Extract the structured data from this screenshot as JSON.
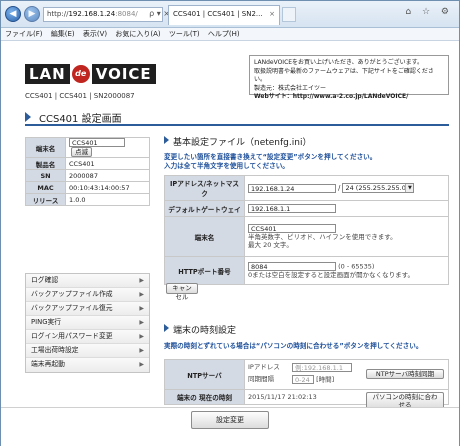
{
  "browser": {
    "back_icon": "back-arrow-icon",
    "forward_icon": "forward-arrow-icon",
    "url_scheme": "http://",
    "url_host": "192.168.1.24",
    "url_port": ":8084/",
    "url_tools": "ρ ▾ ×",
    "tab_title": "CCS401 | CCS401 | SN2...",
    "tab_close": "×",
    "window_icons": "⌂ ☆ ⚙",
    "menu": [
      "ファイル(F)",
      "編集(E)",
      "表示(V)",
      "お気に入り(A)",
      "ツール(T)",
      "ヘルプ(H)"
    ]
  },
  "header": {
    "logo_left": "LAN",
    "logo_mid": "de",
    "logo_right": "VOICE",
    "device_info": "CCS401 | CCS401 | SN2000087",
    "notice_line1": "LANdeVOICEをお買い上げいただき、ありがとうございます。",
    "notice_line2": "取扱説明書や最新のファームウェアは、下記サイトをご確認ください。",
    "notice_line3": "製造元：株式会社エイツー",
    "notice_site_label": "Webサイト",
    "notice_site_url": "：http://www.a-2.co.jp/LANdeVOICE/",
    "page_title": "CCS401 設定画面"
  },
  "device": {
    "rows": [
      {
        "key": "端末名",
        "value": "CCS401",
        "button": "点滅"
      },
      {
        "key": "製品名",
        "value": "CCS401"
      },
      {
        "key": "SN",
        "value": "2000087"
      },
      {
        "key": "MAC",
        "value": "00:10:43:14:00:57"
      },
      {
        "key": "リリース",
        "value": "1.0.0"
      }
    ]
  },
  "sidemenu": {
    "items": [
      "ログ確認",
      "バックアップファイル作成",
      "バックアップファイル復元",
      "PING実行",
      "ログイン用パスワード変更",
      "工場出荷時設定",
      "端末再起動"
    ],
    "arrow": "▶"
  },
  "basic": {
    "heading": "基本設定ファイル（netenfg.ini）",
    "note1": "変更したい箇所を直接書き換えて“設定変更”ボタンを押してください。",
    "note2": "入力は全て半角文字を使用してください。",
    "ip_label": "IPアドレス/ネットマスク",
    "ip_value": "192.168.1.24",
    "ip_sep": "/",
    "mask_value": "24 (255.255.255.0)",
    "gw_label": "デフォルトゲートウェイ",
    "gw_value": "192.168.1.1",
    "name_label": "端末名",
    "name_value": "CCS401",
    "name_hint1": "半角英数字、ピリオド、ハイフンを使用できます。",
    "name_hint2": "最大 20 文字。",
    "port_label": "HTTPポート番号",
    "port_value": "8084",
    "port_range": "(0 - 65535)",
    "port_hint": "0または空白を設定すると設定画面が開かなくなります。",
    "cancel": "キャンセル"
  },
  "time": {
    "heading": "端末の時刻設定",
    "note": "実際の時刻とずれている場合は“パソコンの時刻に合わせる”ボタンを押してください。",
    "ntp_label": "NTPサーバ",
    "ntp_ip_label": "IPアドレス",
    "ntp_ip_placeholder": "例:192.168.1.1",
    "ntp_sync_label": "同期間隔",
    "ntp_sync_placeholder": "0-24",
    "ntp_sync_unit": "[時間]",
    "ntp_sync_button": "NTPサーバ時刻同期",
    "now_label": "端末の 現在の時刻",
    "now_value": "2015/11/17 21:02:13",
    "pc_button": "パソコンの時刻に合わせる"
  },
  "footer": {
    "save": "設定変更"
  }
}
